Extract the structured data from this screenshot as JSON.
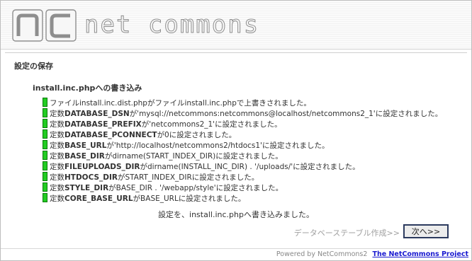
{
  "header": {
    "logo_text": "net commons"
  },
  "section_title": "設定の保存",
  "sub_title": "install.inc.phpへの書き込み",
  "log_lines": [
    {
      "pre": "ファイルinstall.inc.dist.phpがファイルinstall.inc.phpで上書きされました。",
      "key": "",
      "post": ""
    },
    {
      "pre": "定数",
      "key": "DATABASE_DSN",
      "post": "が'mysql://netcommons:netcommons@localhost/netcommons2_1'に設定されました。"
    },
    {
      "pre": "定数",
      "key": "DATABASE_PREFIX",
      "post": "が'netcommons2_1'に設定されました。"
    },
    {
      "pre": "定数",
      "key": "DATABASE_PCONNECT",
      "post": "が0に設定されました。"
    },
    {
      "pre": "定数",
      "key": "BASE_URL",
      "post": "が'http://localhost/netcommons2/htdocs1'に設定されました。"
    },
    {
      "pre": "定数",
      "key": "BASE_DIR",
      "post": "がdirname(START_INDEX_DIR)に設定されました。"
    },
    {
      "pre": "定数",
      "key": "FILEUPLOADS_DIR",
      "post": "がdirname(INSTALL_INC_DIR) . '/uploads/'に設定されました。"
    },
    {
      "pre": "定数",
      "key": "HTDOCS_DIR",
      "post": "がSTART_INDEX_DIRに設定されました。"
    },
    {
      "pre": "定数",
      "key": "STYLE_DIR",
      "post": "がBASE_DIR . '/webapp/style'に設定されました。"
    },
    {
      "pre": "定数",
      "key": "CORE_BASE_URL",
      "post": "がBASE_URLに設定されました。"
    }
  ],
  "done_message": "設定を、install.inc.phpへ書き込みました。",
  "next_label": "データベーステーブル作成>>",
  "next_button": "次へ>>",
  "footer": {
    "powered": "Powered by NetCommons2",
    "link": "The NetCommons Project"
  }
}
